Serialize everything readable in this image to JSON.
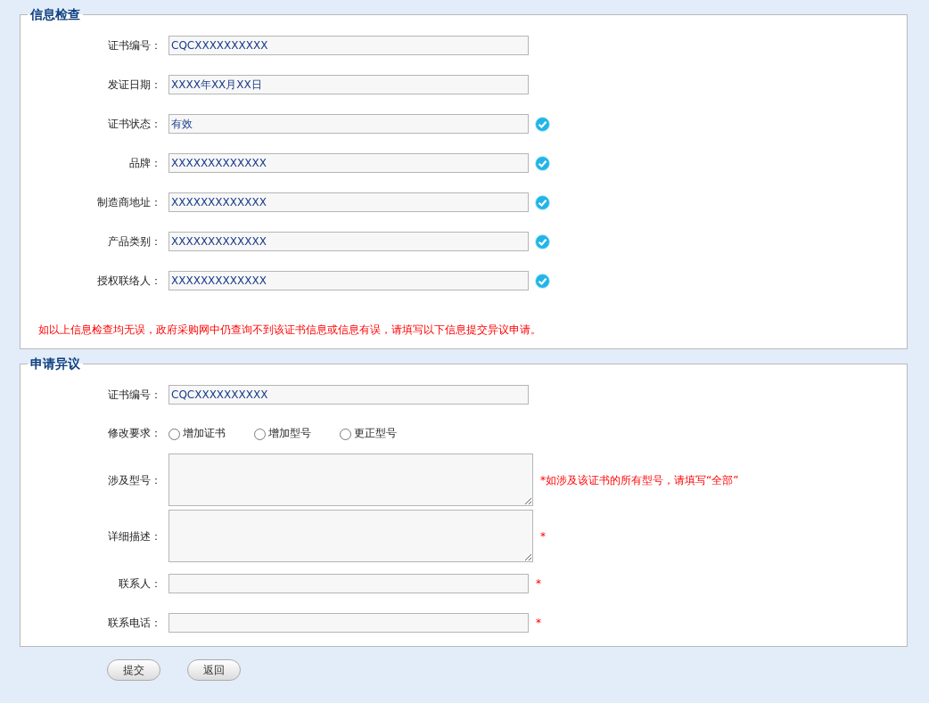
{
  "check_section": {
    "title": "信息检查",
    "fields": [
      {
        "label": "证书编号：",
        "value": "CQCXXXXXXXXXX",
        "verified": false
      },
      {
        "label": "发证日期：",
        "value": "XXXX年XX月XX日",
        "verified": false
      },
      {
        "label": "证书状态：",
        "value": "有效",
        "verified": true
      },
      {
        "label": "品牌：",
        "value": "XXXXXXXXXXXXX",
        "verified": true
      },
      {
        "label": "制造商地址：",
        "value": "XXXXXXXXXXXXX",
        "verified": true
      },
      {
        "label": "产品类别：",
        "value": "XXXXXXXXXXXXX",
        "verified": true
      },
      {
        "label": "授权联络人：",
        "value": "XXXXXXXXXXXXX",
        "verified": true
      }
    ],
    "notice": "如以上信息检查均无误，政府采购网中仍查询不到该证书信息或信息有误，请填写以下信息提交异议申请。"
  },
  "objection_section": {
    "title": "申请异议",
    "fields": [
      {
        "kind": "text",
        "label": "证书编号：",
        "value": "CQCXXXXXXXXXX"
      },
      {
        "kind": "radio",
        "label": "修改要求：",
        "options": [
          {
            "label": "增加证书",
            "selected": false
          },
          {
            "label": "增加型号",
            "selected": false
          },
          {
            "label": "更正型号",
            "selected": false
          }
        ]
      },
      {
        "kind": "textarea",
        "label": "涉及型号：",
        "note": "*如涉及该证书的所有型号，请填写“全部”"
      },
      {
        "kind": "textarea",
        "label": "详细描述：",
        "note": "*"
      },
      {
        "kind": "text",
        "label": "联系人：",
        "note": "*"
      },
      {
        "kind": "text",
        "label": "联系电话：",
        "note": "*"
      }
    ]
  },
  "buttons": [
    "提交",
    "返回"
  ]
}
